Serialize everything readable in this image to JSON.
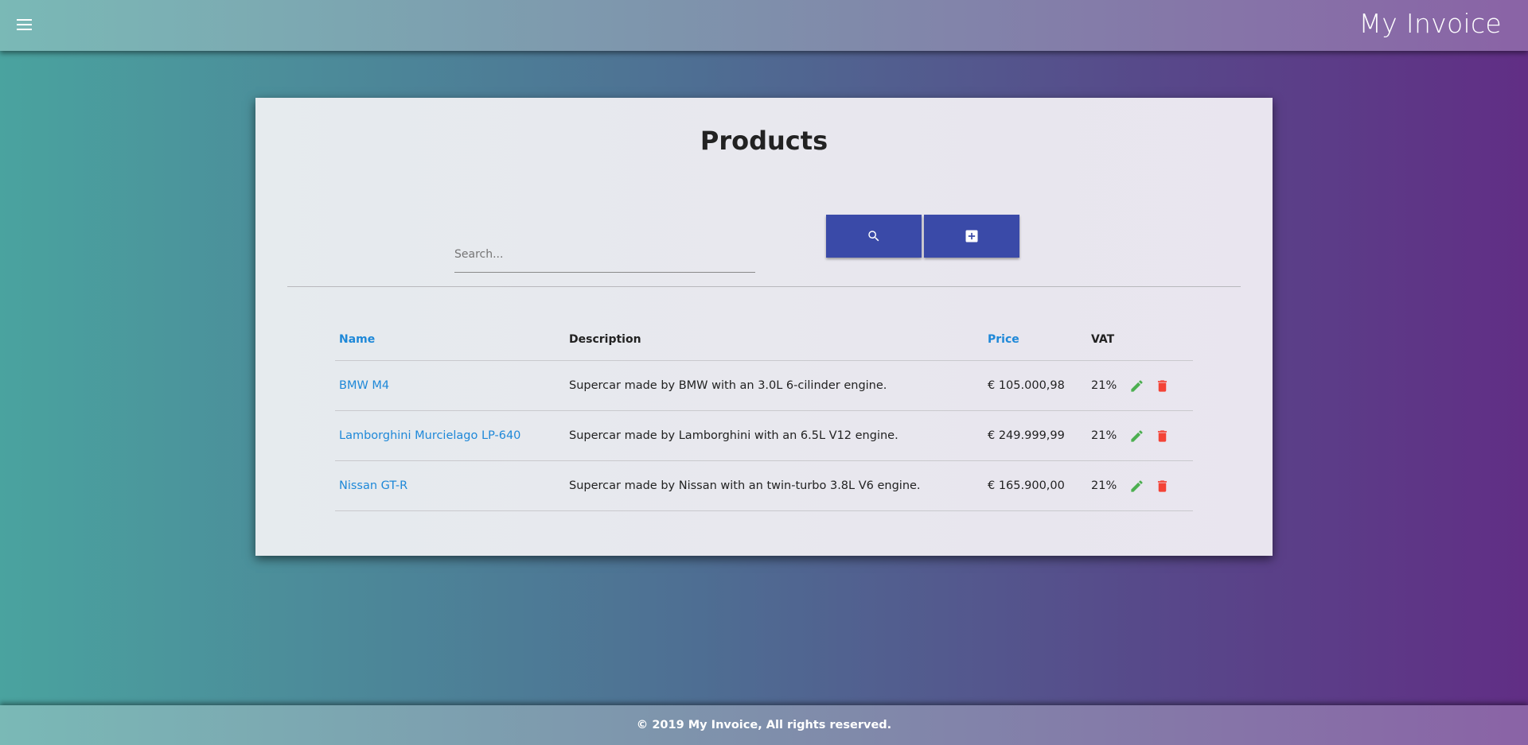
{
  "header": {
    "menu_icon": "menu-icon",
    "app_title": "My Invoice"
  },
  "products": {
    "title": "Products",
    "search": {
      "placeholder": "Search...",
      "value": ""
    },
    "search_button_icon": "search-icon",
    "add_button_icon": "add-box-icon",
    "table": {
      "columns": {
        "name": "Name",
        "description": "Description",
        "price": "Price",
        "vat": "VAT"
      },
      "rows": [
        {
          "name": "BMW M4",
          "description": "Supercar made by BMW with an 3.0L 6-cilinder engine.",
          "price": "€ 105.000,98",
          "vat": "21%"
        },
        {
          "name": "Lamborghini Murcielago LP-640",
          "description": "Supercar made by Lamborghini with an 6.5L V12 engine.",
          "price": "€ 249.999,99",
          "vat": "21%"
        },
        {
          "name": "Nissan GT-R",
          "description": "Supercar made by Nissan with an twin-turbo 3.8L V6 engine.",
          "price": "€ 165.900,00",
          "vat": "21%"
        }
      ],
      "row_actions": {
        "edit_icon": "pencil-icon",
        "delete_icon": "trash-icon"
      }
    }
  },
  "colors": {
    "primary_button": "#3a4aa8",
    "link": "#1e88d8",
    "edit": "#4caf50",
    "delete": "#f44336"
  },
  "footer": {
    "text": "© 2019 My Invoice, All rights reserved."
  }
}
